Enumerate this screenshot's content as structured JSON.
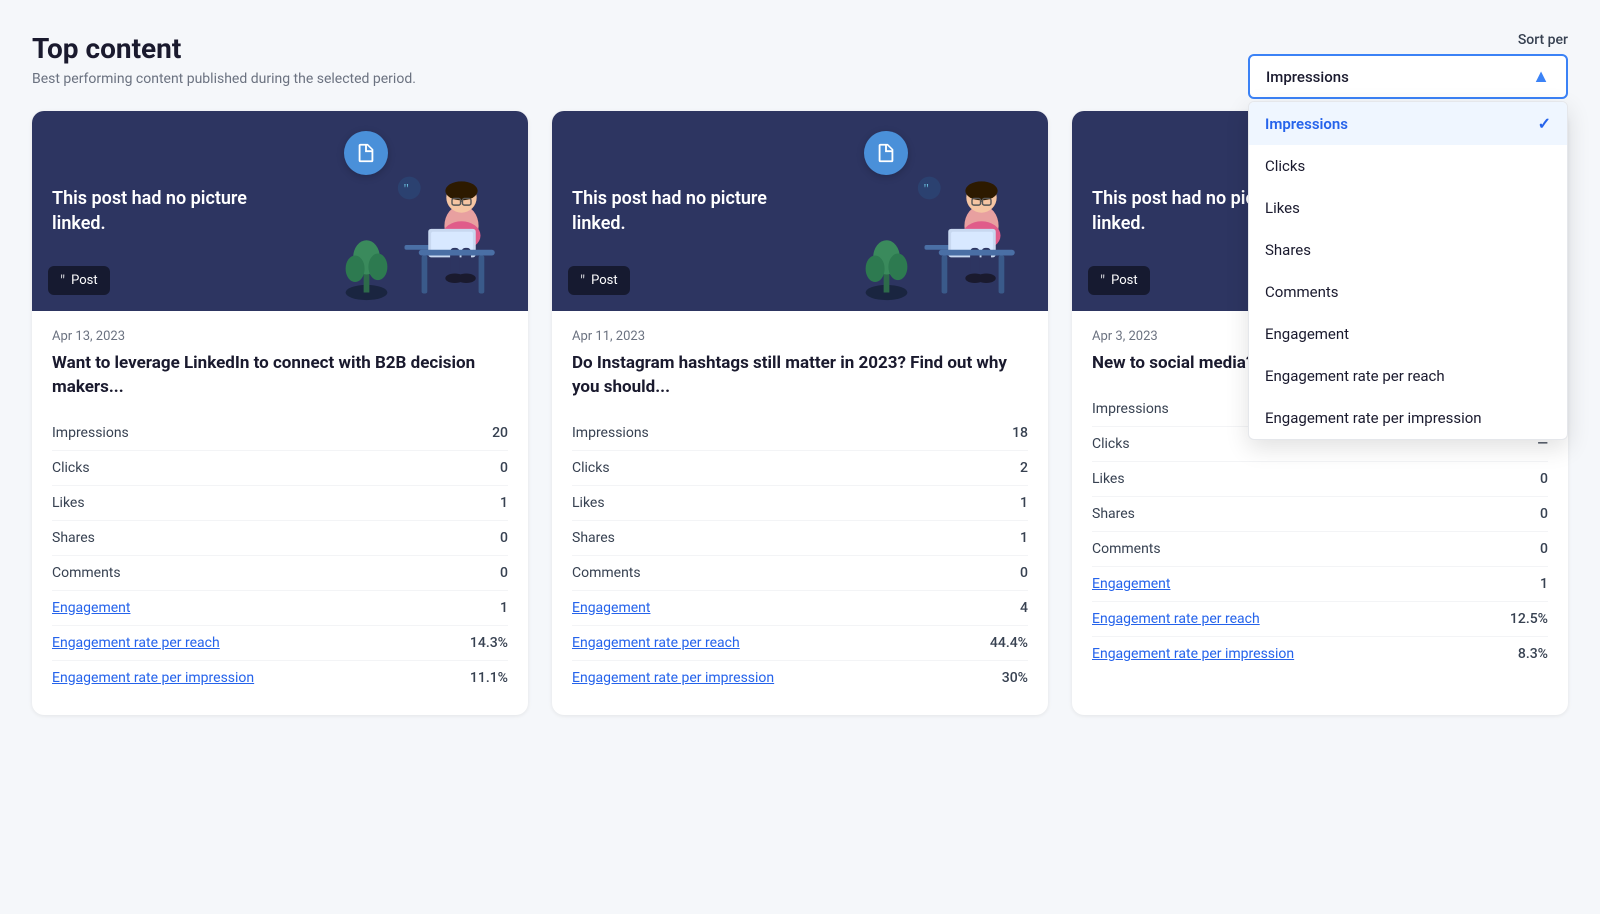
{
  "page": {
    "title": "Top content",
    "subtitle": "Best performing content published during the selected period."
  },
  "sort": {
    "label": "Sort per",
    "selected": "Impressions",
    "options": [
      {
        "value": "Impressions",
        "label": "Impressions",
        "active": true
      },
      {
        "value": "Clicks",
        "label": "Clicks",
        "active": false
      },
      {
        "value": "Likes",
        "label": "Likes",
        "active": false
      },
      {
        "value": "Shares",
        "label": "Shares",
        "active": false
      },
      {
        "value": "Comments",
        "label": "Comments",
        "active": false
      },
      {
        "value": "Engagement",
        "label": "Engagement",
        "active": false
      },
      {
        "value": "Engagement rate per reach",
        "label": "Engagement rate per reach",
        "active": false
      },
      {
        "value": "Engagement rate per impression",
        "label": "Engagement rate per impression",
        "active": false
      }
    ]
  },
  "cards": [
    {
      "image_text": "This post had no picture linked.",
      "badge": "Post",
      "date": "Apr 13, 2023",
      "title": "Want to leverage LinkedIn to connect with B2B decision makers...",
      "metrics": [
        {
          "label": "Impressions",
          "value": "20",
          "is_link": false
        },
        {
          "label": "Clicks",
          "value": "0",
          "is_link": false
        },
        {
          "label": "Likes",
          "value": "1",
          "is_link": false
        },
        {
          "label": "Shares",
          "value": "0",
          "is_link": false
        },
        {
          "label": "Comments",
          "value": "0",
          "is_link": false
        },
        {
          "label": "Engagement",
          "value": "1",
          "is_link": true
        },
        {
          "label": "Engagement rate per reach",
          "value": "14.3%",
          "is_link": true
        },
        {
          "label": "Engagement rate per impression",
          "value": "11.1%",
          "is_link": true
        }
      ]
    },
    {
      "image_text": "This post had no picture linked.",
      "badge": "Post",
      "date": "Apr 11, 2023",
      "title": "Do Instagram hashtags still matter in 2023? Find out why you should...",
      "metrics": [
        {
          "label": "Impressions",
          "value": "18",
          "is_link": false
        },
        {
          "label": "Clicks",
          "value": "2",
          "is_link": false
        },
        {
          "label": "Likes",
          "value": "1",
          "is_link": false
        },
        {
          "label": "Shares",
          "value": "1",
          "is_link": false
        },
        {
          "label": "Comments",
          "value": "0",
          "is_link": false
        },
        {
          "label": "Engagement",
          "value": "4",
          "is_link": true
        },
        {
          "label": "Engagement rate per reach",
          "value": "44.4%",
          "is_link": true
        },
        {
          "label": "Engagement rate per impression",
          "value": "30%",
          "is_link": true
        }
      ]
    },
    {
      "image_text": "This post had no picture linked.",
      "badge": "Post",
      "date": "Apr 3, 2023",
      "title": "New to social media? Get ready to...",
      "metrics": [
        {
          "label": "Impressions",
          "value": "—",
          "is_link": false
        },
        {
          "label": "Clicks",
          "value": "—",
          "is_link": false
        },
        {
          "label": "Likes",
          "value": "0",
          "is_link": false
        },
        {
          "label": "Shares",
          "value": "0",
          "is_link": false
        },
        {
          "label": "Comments",
          "value": "0",
          "is_link": false
        },
        {
          "label": "Engagement",
          "value": "1",
          "is_link": true
        },
        {
          "label": "Engagement rate per reach",
          "value": "12.5%",
          "is_link": true
        },
        {
          "label": "Engagement rate per impression",
          "value": "8.3%",
          "is_link": true
        }
      ]
    }
  ]
}
